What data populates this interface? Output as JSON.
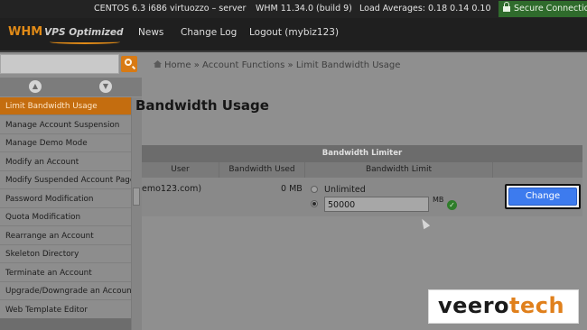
{
  "status_bar": {
    "host": "CENTOS 6.3 i686 virtuozzo – server",
    "whm": "WHM 11.34.0 (build 9)",
    "load": "Load Averages: 0.18 0.14 0.10",
    "secure": "Secure Connection"
  },
  "header": {
    "logo_main": "WHM",
    "logo_sub": "VPS Optimized",
    "nav": [
      "News",
      "Change Log",
      "Logout (mybiz123)"
    ]
  },
  "breadcrumb": {
    "home": "Home",
    "sep": "»",
    "section": "Account Functions",
    "current": "Limit Bandwidth Usage"
  },
  "page": {
    "title": "Bandwidth Usage"
  },
  "sidebar": {
    "items": [
      "Limit Bandwidth Usage",
      "Manage Account Suspension",
      "Manage Demo Mode",
      "Modify an Account",
      "Modify Suspended Account Page",
      "Password Modification",
      "Quota Modification",
      "Rearrange an Account",
      "Skeleton Directory",
      "Terminate an Account",
      "Upgrade/Downgrade an Account",
      "Web Template Editor"
    ],
    "active_index": 0
  },
  "table": {
    "caption": "Bandwidth Limiter",
    "headers": [
      "User",
      "Bandwidth Used",
      "Bandwidth Limit"
    ],
    "row": {
      "user": "emo123.com)",
      "used": "0 MB",
      "unlimited_label": "Unlimited",
      "limit_value": "50000",
      "unit": "MB"
    },
    "change_label": "Change"
  },
  "watermark": {
    "part1": "veero",
    "part2": "tech"
  }
}
